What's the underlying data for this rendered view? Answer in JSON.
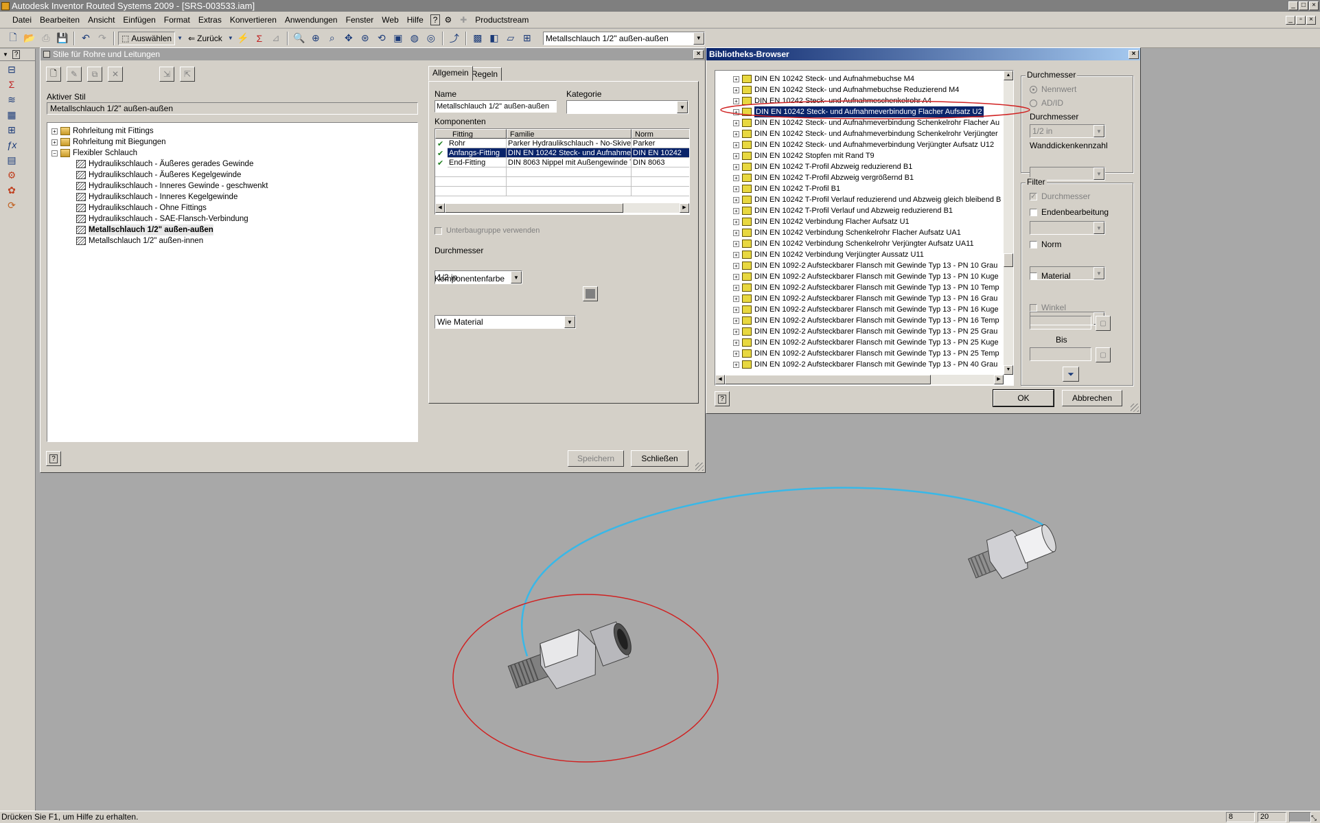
{
  "app": {
    "title": "Autodesk Inventor Routed Systems 2009 - [SRS-003533.iam]"
  },
  "menu": [
    "Datei",
    "Bearbeiten",
    "Ansicht",
    "Einfügen",
    "Format",
    "Extras",
    "Konvertieren",
    "Anwendungen",
    "Fenster",
    "Web",
    "Hilfe",
    "Productstream"
  ],
  "toolbar": {
    "select_label": "Auswählen",
    "back_label": "Zurück",
    "style_combo_value": "Metallschlauch 1/2\" außen-außen"
  },
  "styles_dialog": {
    "title": "Stile für Rohre und Leitungen",
    "active_style_label": "Aktiver Stil",
    "active_style_value": "Metallschlauch 1/2\" außen-außen",
    "tree": [
      {
        "label": "Rohrleitung mit Fittings",
        "level": 0,
        "expander": "+",
        "icon": "folder"
      },
      {
        "label": "Rohrleitung mit Biegungen",
        "level": 0,
        "expander": "+",
        "icon": "folder"
      },
      {
        "label": "Flexibler Schlauch",
        "level": 0,
        "expander": "-",
        "icon": "folder"
      },
      {
        "label": "Hydraulikschlauch - Äußeres gerades Gewinde",
        "level": 1,
        "icon": "hose"
      },
      {
        "label": "Hydraulikschlauch - Äußeres Kegelgewinde",
        "level": 1,
        "icon": "hose"
      },
      {
        "label": "Hydraulikschlauch - Inneres Gewinde - geschwenkt",
        "level": 1,
        "icon": "hose"
      },
      {
        "label": "Hydraulikschlauch - Inneres Kegelgewinde",
        "level": 1,
        "icon": "hose"
      },
      {
        "label": "Hydraulikschlauch - Ohne Fittings",
        "level": 1,
        "icon": "hose"
      },
      {
        "label": "Hydraulikschlauch - SAE-Flansch-Verbindung",
        "level": 1,
        "icon": "hose"
      },
      {
        "label": "Metallschlauch 1/2\" außen-außen",
        "level": 1,
        "icon": "hose",
        "active": true
      },
      {
        "label": "Metallschlauch 1/2\" außen-innen",
        "level": 1,
        "icon": "hose"
      }
    ],
    "tabs": [
      "Allgemein",
      "Regeln"
    ],
    "name_label": "Name",
    "name_value": "Metallschlauch 1/2\" außen-außen",
    "category_label": "Kategorie",
    "category_value": "",
    "components_label": "Komponenten",
    "grid_headers": [
      "Fitting",
      "Familie",
      "Norm"
    ],
    "grid_rows": [
      {
        "fitting": "Rohr",
        "familie": "Parker Hydraulikschlauch - No-Skive",
        "norm": "Parker",
        "selected": false
      },
      {
        "fitting": "Anfangs-Fitting",
        "familie": "DIN EN 10242 Steck- und Aufnahme",
        "norm": "DIN EN 10242",
        "selected": true
      },
      {
        "fitting": "End-Fitting",
        "familie": "DIN 8063 Nippel mit Außengewinde T",
        "norm": "DIN 8063",
        "selected": false
      }
    ],
    "subassembly_label": "Unterbaugruppe verwenden",
    "diameter_label": "Durchmesser",
    "diameter_value": "1/2 in",
    "color_label": "Komponentenfarbe",
    "color_value": "Wie Material",
    "save_label": "Speichern",
    "close_label": "Schließen"
  },
  "library_dialog": {
    "title": "Bibliotheks-Browser",
    "items": [
      "DIN EN 10242 Steck- und Aufnahmebuchse M4",
      "DIN EN 10242 Steck- und Aufnahmebuchse Reduzierend M4",
      "DIN EN 10242 Steck- und Aufnahmeschenkelrohr A4",
      "DIN EN 10242 Steck- und Aufnahmeverbindung Flacher Aufsatz U2",
      "DIN EN 10242 Steck- und Aufnahmeverbindung Schenkelrohr Flacher Au",
      "DIN EN 10242 Steck- und Aufnahmeverbindung Schenkelrohr Verjüngter",
      "DIN EN 10242 Steck- und Aufnahmeverbindung Verjüngter Aufsatz U12",
      "DIN EN 10242 Stopfen mit Rand T9",
      "DIN EN 10242 T-Profil Abzweig reduzierend B1",
      "DIN EN 10242 T-Profil Abzweig vergrößernd B1",
      "DIN EN 10242 T-Profil B1",
      "DIN EN 10242 T-Profil Verlauf reduzierend und Abzweig gleich bleibend B",
      "DIN EN 10242 T-Profil Verlauf und Abzweig reduzierend B1",
      "DIN EN 10242 Verbindung Flacher Aufsatz U1",
      "DIN EN 10242 Verbindung Schenkelrohr Flacher Aufsatz UA1",
      "DIN EN 10242 Verbindung Schenkelrohr Verjüngter Aufsatz UA11",
      "DIN EN 10242 Verbindung Verjüngter Aussatz U11",
      "DIN EN 1092-2 Aufsteckbarer Flansch mit Gewinde Typ 13 - PN 10 Grau",
      "DIN EN 1092-2 Aufsteckbarer Flansch mit Gewinde Typ 13 - PN 10 Kuge",
      "DIN EN 1092-2 Aufsteckbarer Flansch mit Gewinde Typ 13 - PN 10 Temp",
      "DIN EN 1092-2 Aufsteckbarer Flansch mit Gewinde Typ 13 - PN 16 Grau",
      "DIN EN 1092-2 Aufsteckbarer Flansch mit Gewinde Typ 13 - PN 16 Kuge",
      "DIN EN 1092-2 Aufsteckbarer Flansch mit Gewinde Typ 13 - PN 16 Temp",
      "DIN EN 1092-2 Aufsteckbarer Flansch mit Gewinde Typ 13 - PN 25 Grau",
      "DIN EN 1092-2 Aufsteckbarer Flansch mit Gewinde Typ 13 - PN 25 Kuge",
      "DIN EN 1092-2 Aufsteckbarer Flansch mit Gewinde Typ 13 - PN 25 Temp",
      "DIN EN 1092-2 Aufsteckbarer Flansch mit Gewinde Typ 13 - PN 40 Grau"
    ],
    "selected_index": 3,
    "diameter_group_label": "Durchmesser",
    "radio_nominal": "Nennwert",
    "radio_adid": "AD/ID",
    "diameter_label": "Durchmesser",
    "diameter_value": "1/2 in",
    "wall_label": "Wanddickenkennzahl",
    "filter_group_label": "Filter",
    "filter_diameter": "Durchmesser",
    "filter_end": "Endenbearbeitung",
    "filter_norm": "Norm",
    "filter_material": "Material",
    "filter_angle": "Winkel",
    "filter_to": "Bis",
    "ok_label": "OK",
    "cancel_label": "Abbrechen"
  },
  "status": {
    "text": "Drücken Sie F1, um Hilfe zu erhalten.",
    "field1": "8",
    "field2": "20"
  },
  "colors": {
    "viewport": "#a8a8a8",
    "hose": "#38b8e8",
    "annotation": "#d02020",
    "selection": "#0a246a"
  }
}
